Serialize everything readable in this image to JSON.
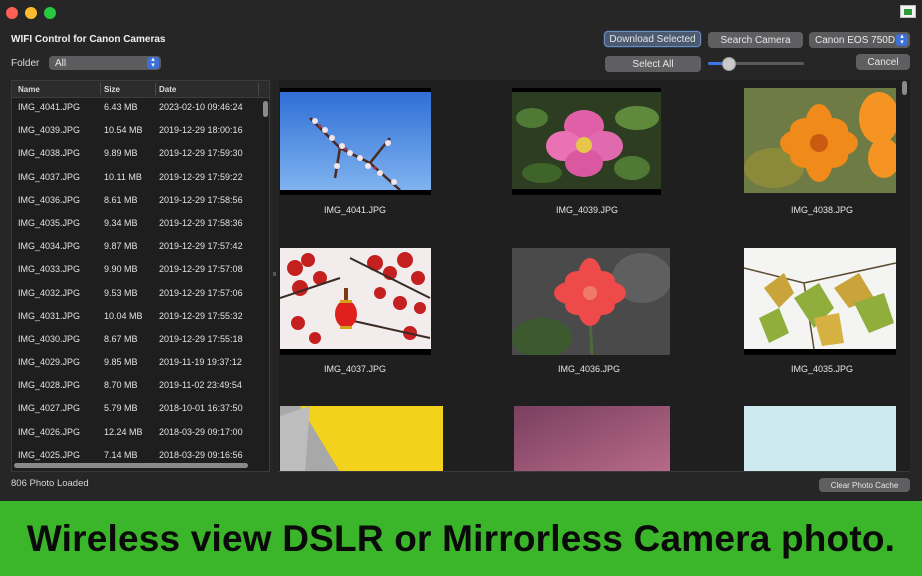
{
  "window": {
    "title": "WIFI Control for Canon Cameras"
  },
  "toolbar": {
    "download_selected": "Download Selected",
    "search_camera": "Search Camera",
    "camera_model": "Canon EOS 750D",
    "select_all": "Select All",
    "cancel": "Cancel",
    "thumbnail_size_fraction": 0.17
  },
  "folder": {
    "label": "Folder",
    "selected": "All"
  },
  "table": {
    "columns": [
      "Name",
      "Size",
      "Date"
    ],
    "rows": [
      {
        "name": "IMG_4041.JPG",
        "size": "6.43 MB",
        "date": "2023-02-10 09:46:24"
      },
      {
        "name": "IMG_4039.JPG",
        "size": "10.54 MB",
        "date": "2019-12-29 18:00:16"
      },
      {
        "name": "IMG_4038.JPG",
        "size": "9.89 MB",
        "date": "2019-12-29 17:59:30"
      },
      {
        "name": "IMG_4037.JPG",
        "size": "10.11 MB",
        "date": "2019-12-29 17:59:22"
      },
      {
        "name": "IMG_4036.JPG",
        "size": "8.61 MB",
        "date": "2019-12-29 17:58:56"
      },
      {
        "name": "IMG_4035.JPG",
        "size": "9.34 MB",
        "date": "2019-12-29 17:58:36"
      },
      {
        "name": "IMG_4034.JPG",
        "size": "9.87 MB",
        "date": "2019-12-29 17:57:42"
      },
      {
        "name": "IMG_4033.JPG",
        "size": "9.90 MB",
        "date": "2019-12-29 17:57:08"
      },
      {
        "name": "IMG_4032.JPG",
        "size": "9.53 MB",
        "date": "2019-12-29 17:57:06"
      },
      {
        "name": "IMG_4031.JPG",
        "size": "10.04 MB",
        "date": "2019-12-29 17:55:32"
      },
      {
        "name": "IMG_4030.JPG",
        "size": "8.67 MB",
        "date": "2019-12-29 17:55:18"
      },
      {
        "name": "IMG_4029.JPG",
        "size": "9.85 MB",
        "date": "2019-11-19 19:37:12"
      },
      {
        "name": "IMG_4028.JPG",
        "size": "8.70 MB",
        "date": "2019-11-02 23:49:54"
      },
      {
        "name": "IMG_4027.JPG",
        "size": "5.79 MB",
        "date": "2018-10-01 16:37:50"
      },
      {
        "name": "IMG_4026.JPG",
        "size": "12.24 MB",
        "date": "2018-03-29 09:17:00"
      },
      {
        "name": "IMG_4025.JPG",
        "size": "7.14 MB",
        "date": "2018-03-29 09:16:56"
      }
    ]
  },
  "gallery": {
    "captions": [
      "IMG_4041.JPG",
      "IMG_4039.JPG",
      "IMG_4038.JPG",
      "IMG_4037.JPG",
      "IMG_4036.JPG",
      "IMG_4035.JPG"
    ]
  },
  "status": {
    "loaded": "806 Photo Loaded",
    "clear_cache": "Clear Photo Cache"
  },
  "banner": {
    "text": "Wireless view DSLR or Mirrorless Camera photo."
  },
  "colors": {
    "banner_green": "#3bb52a",
    "accent_blue": "#3d76e6",
    "window_bg": "#262626"
  }
}
